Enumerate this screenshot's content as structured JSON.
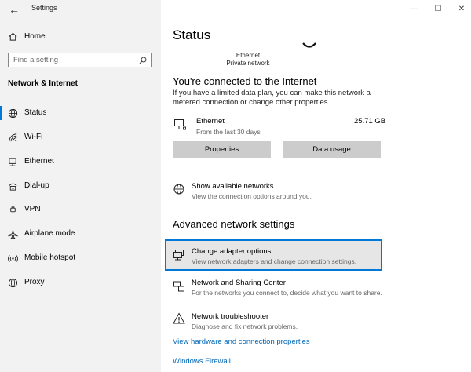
{
  "window": {
    "title": "Settings",
    "controls": {
      "minimize": "—",
      "maximize": "☐",
      "close": "✕"
    }
  },
  "sidebar": {
    "back": "←",
    "home_label": "Home",
    "search_placeholder": "Find a setting",
    "section_title": "Network & Internet",
    "items": [
      {
        "label": "Status",
        "icon": "status-globe-icon",
        "active": true
      },
      {
        "label": "Wi-Fi",
        "icon": "wifi-icon",
        "active": false
      },
      {
        "label": "Ethernet",
        "icon": "ethernet-icon",
        "active": false
      },
      {
        "label": "Dial-up",
        "icon": "dialup-icon",
        "active": false
      },
      {
        "label": "VPN",
        "icon": "vpn-icon",
        "active": false
      },
      {
        "label": "Airplane mode",
        "icon": "airplane-icon",
        "active": false
      },
      {
        "label": "Mobile hotspot",
        "icon": "hotspot-icon",
        "active": false
      },
      {
        "label": "Proxy",
        "icon": "globe-icon",
        "active": false
      }
    ]
  },
  "main": {
    "title": "Status",
    "ethernet_diagram": {
      "name": "Ethernet",
      "network": "Private network"
    },
    "connected_heading": "You're connected to the Internet",
    "connected_text": "If you have a limited data plan, you can make this network a metered connection or change other properties.",
    "connection": {
      "name": "Ethernet",
      "period": "From the last 30 days",
      "usage": "25.71 GB"
    },
    "buttons": {
      "properties": "Properties",
      "data_usage": "Data usage"
    },
    "show_networks": {
      "title": "Show available networks",
      "desc": "View the connection options around you."
    },
    "advanced_heading": "Advanced network settings",
    "adapter": {
      "title": "Change adapter options",
      "desc": "View network adapters and change connection settings."
    },
    "sharing": {
      "title": "Network and Sharing Center",
      "desc": "For the networks you connect to, decide what you want to share."
    },
    "troubleshooter": {
      "title": "Network troubleshooter",
      "desc": "Diagnose and fix network problems."
    },
    "links": {
      "hardware": "View hardware and connection properties",
      "firewall": "Windows Firewall"
    }
  }
}
